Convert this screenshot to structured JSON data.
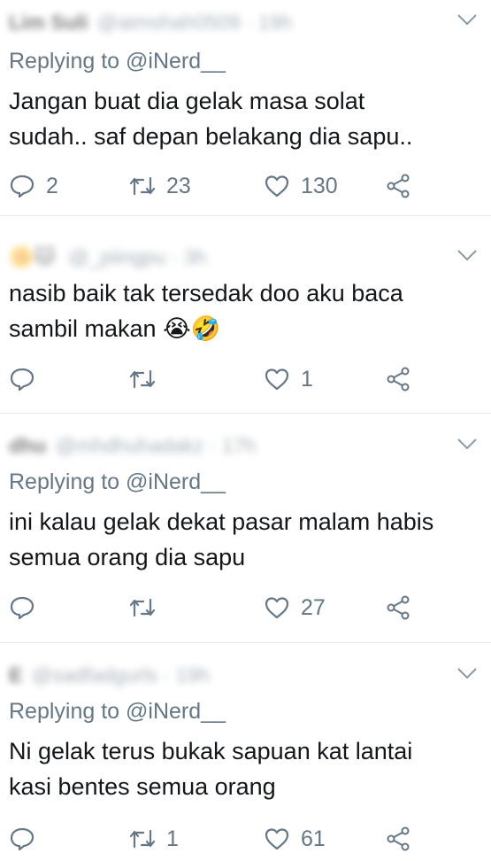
{
  "tweets": [
    {
      "name": "Lim Suli",
      "handle": "@aimshah0509 · 19h",
      "replying_prefix": "Replying to",
      "replying_to": "@iNerd__",
      "lines": [
        "Jangan buat dia gelak masa solat",
        "sudah.. saf depan belakang dia sapu.."
      ],
      "reply_count": "2",
      "retweet_count": "23",
      "like_count": "130"
    },
    {
      "name": "🌼🐱",
      "handle": "@_piingpu · 3h",
      "lines": [
        "nasib baik tak tersedak doo aku baca",
        "sambil makan 😭🤣"
      ],
      "reply_count": "",
      "retweet_count": "",
      "like_count": "1"
    },
    {
      "name": "dhu",
      "handle": "@mhdhuhadakz · 17h",
      "replying_prefix": "Replying to",
      "replying_to": "@iNerd__",
      "lines": [
        "ini kalau gelak dekat pasar malam habis",
        "semua orang dia sapu"
      ],
      "reply_count": "",
      "retweet_count": "",
      "like_count": "27"
    },
    {
      "name": "E",
      "handle": "@sadfadgurls · 19h",
      "replying_prefix": "Replying to",
      "replying_to": "@iNerd__",
      "lines": [
        "Ni gelak terus bukak sapuan kat lantai",
        "kasi bentes semua orang"
      ],
      "reply_count": "",
      "retweet_count": "1",
      "like_count": "61"
    }
  ],
  "icons": {
    "reply": "reply-icon",
    "retweet": "retweet-icon",
    "like": "heart-icon",
    "share": "share-icon",
    "menu": "chevron-down-icon"
  },
  "colors": {
    "muted": "#657786",
    "text": "#14171a",
    "divider": "#e1e8ed"
  }
}
